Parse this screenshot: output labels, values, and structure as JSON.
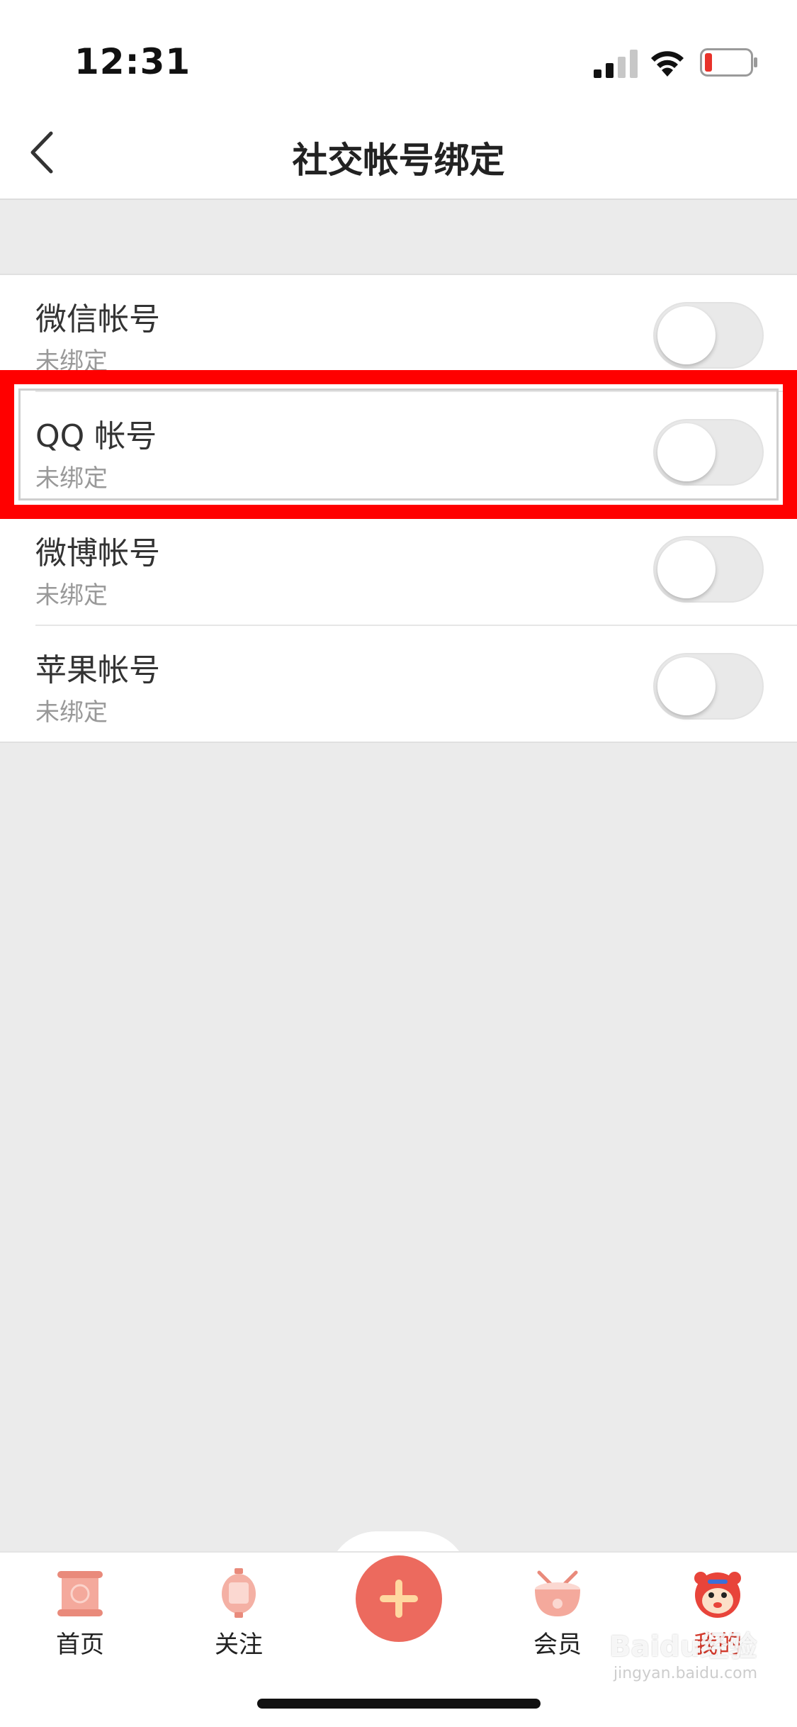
{
  "status_bar": {
    "time": "12:31"
  },
  "nav": {
    "title": "社交帐号绑定"
  },
  "accounts": [
    {
      "title": "微信帐号",
      "status": "未绑定",
      "enabled": false
    },
    {
      "title": "QQ 帐号",
      "status": "未绑定",
      "enabled": false
    },
    {
      "title": "微博帐号",
      "status": "未绑定",
      "enabled": false
    },
    {
      "title": "苹果帐号",
      "status": "未绑定",
      "enabled": false
    }
  ],
  "tabs": [
    {
      "label": "首页",
      "icon": "scroll-icon"
    },
    {
      "label": "关注",
      "icon": "lantern-icon"
    },
    {
      "label": "",
      "icon": "plus-icon"
    },
    {
      "label": "会员",
      "icon": "drum-icon"
    },
    {
      "label": "我的",
      "icon": "tiger-avatar-icon",
      "active": true
    }
  ],
  "watermark": {
    "brand": "Baidu经验",
    "url": "jingyan.baidu.com"
  },
  "colors": {
    "highlight": "#ff0000",
    "accent": "#ec6a5e",
    "active_tab": "#d33a2c",
    "background": "#ebebeb"
  }
}
